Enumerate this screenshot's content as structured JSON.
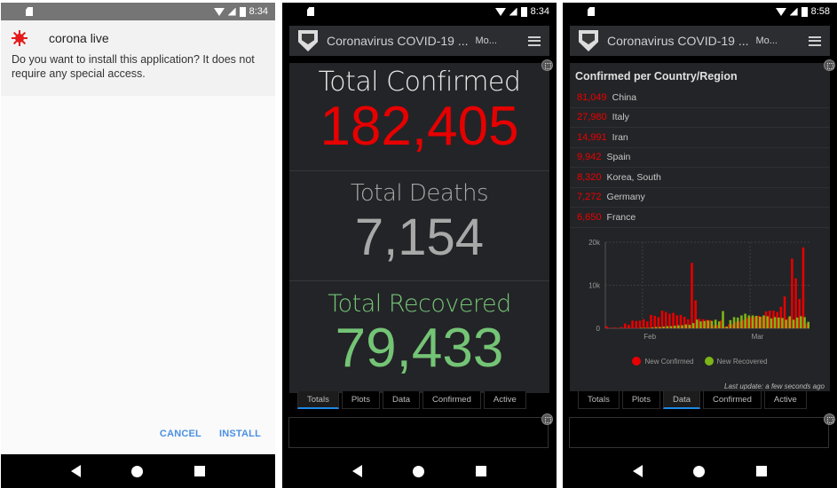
{
  "phone1": {
    "status": {
      "time": "8:34"
    },
    "app": {
      "name": "corona live",
      "icon": "virus-icon"
    },
    "message": "Do you want to install this application? It does not require any special access.",
    "buttons": {
      "cancel": "CANCEL",
      "install": "INSTALL"
    }
  },
  "phone2": {
    "status": {
      "time": "8:34"
    },
    "header": {
      "title": "Coronavirus COVID-19 ...",
      "subtitle": "Mo...",
      "logo": "shield-icon"
    },
    "totals": {
      "confirmed": {
        "label": "Total Confirmed",
        "value": "182,405",
        "color": "#e60000"
      },
      "deaths": {
        "label": "Total Deaths",
        "value": "7,154",
        "color": "#a8a8a8"
      },
      "recovered": {
        "label": "Total Recovered",
        "value": "79,433",
        "color": "#74c476"
      }
    },
    "tabs": [
      {
        "label": "Totals",
        "active": true
      },
      {
        "label": "Plots",
        "active": false
      },
      {
        "label": "Data",
        "active": false
      },
      {
        "label": "Confirmed",
        "active": false
      },
      {
        "label": "Active",
        "active": false
      }
    ]
  },
  "phone3": {
    "status": {
      "time": "8:58"
    },
    "header": {
      "title": "Coronavirus COVID-19 ...",
      "subtitle": "Mo...",
      "logo": "shield-icon"
    },
    "panel_title": "Confirmed per Country/Region",
    "countries": [
      {
        "count": "81,049",
        "name": "China"
      },
      {
        "count": "27,980",
        "name": "Italy"
      },
      {
        "count": "14,991",
        "name": "Iran"
      },
      {
        "count": "9,942",
        "name": "Spain"
      },
      {
        "count": "8,320",
        "name": "Korea, South"
      },
      {
        "count": "7,272",
        "name": "Germany"
      },
      {
        "count": "6,650",
        "name": "France"
      }
    ],
    "last_update": "Last update: a few seconds ago",
    "tabs": [
      {
        "label": "Totals",
        "active": false
      },
      {
        "label": "Plots",
        "active": false
      },
      {
        "label": "Data",
        "active": true
      },
      {
        "label": "Confirmed",
        "active": false
      },
      {
        "label": "Active",
        "active": false
      }
    ]
  },
  "chart_data": {
    "type": "bar",
    "title": "",
    "xlabel": "",
    "ylabel": "",
    "ylim": [
      0,
      20000
    ],
    "yticks": [
      "0",
      "10k",
      "20k"
    ],
    "xticks": [
      {
        "label": "Feb",
        "index": 10
      },
      {
        "label": "Mar",
        "index": 39
      }
    ],
    "grid": true,
    "legend_position": "bottom",
    "series": [
      {
        "name": "New Confirmed",
        "color": "#e60000",
        "values": [
          500,
          100,
          200,
          100,
          300,
          1100,
          800,
          1800,
          1700,
          1800,
          2100,
          1600,
          3100,
          2900,
          2600,
          4100,
          3800,
          3400,
          3600,
          3000,
          3100,
          2700,
          2100,
          15200,
          6500,
          2200,
          2100,
          2000,
          1900,
          600,
          800,
          1900,
          400,
          900,
          1000,
          1500,
          1600,
          2000,
          2400,
          2600,
          2700,
          2900,
          2700,
          3900,
          4100,
          4100,
          3800,
          5000,
          7400,
          2500,
          16200,
          11600,
          6800,
          18800,
          1100
        ]
      },
      {
        "name": "New Recovered",
        "color": "#7cb518",
        "values": [
          0,
          0,
          0,
          0,
          0,
          0,
          0,
          0,
          0,
          100,
          100,
          100,
          200,
          300,
          300,
          400,
          500,
          500,
          600,
          700,
          700,
          900,
          800,
          1200,
          2000,
          1600,
          1700,
          1800,
          1700,
          2000,
          1600,
          4000,
          400,
          1900,
          2600,
          2500,
          3000,
          3400,
          3000,
          3000,
          2900,
          2700,
          3000,
          2800,
          2300,
          2600,
          2500,
          2400,
          2000,
          2800,
          2000,
          2500,
          2800,
          2600,
          1500
        ]
      }
    ]
  }
}
